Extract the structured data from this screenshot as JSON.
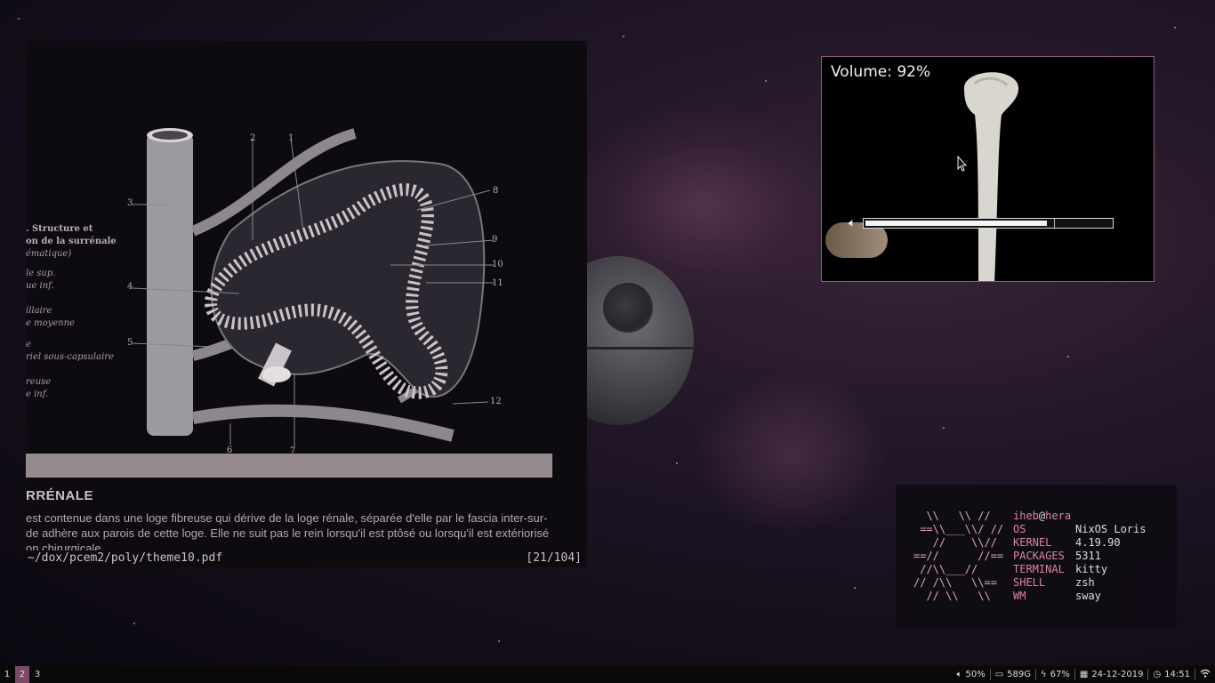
{
  "pdf_viewer": {
    "figure": {
      "side_caption": {
        "title_line1": ". Structure et",
        "title_line2": "on de la surrénale",
        "subtitle": "ématique)",
        "items": [
          "le sup.",
          "ue inf.",
          "illaire",
          "e moyenne",
          "e",
          "riel sous-capsulaire",
          "reuse",
          "e inf."
        ]
      },
      "numbers": [
        "1",
        "2",
        "3",
        "4",
        "5",
        "6",
        "7",
        "8",
        "9",
        "10",
        "11",
        "12"
      ]
    },
    "heading": "RRÉNALE",
    "paragraph_lines": [
      "est contenue dans une loge fibreuse qui dérive de la loge rénale, séparée d'elle par le fascia inter-sur-",
      "de adhère aux parois de cette loge. Elle ne suit pas le rein lorsqu'il est ptôsé ou lorsqu'il est extériorisé",
      "on chirurgicale."
    ],
    "file_path": "~/dox/pcem2/poly/theme10.pdf",
    "page_indicator": "[21/104]"
  },
  "video": {
    "volume_text": "Volume: 92%",
    "volume_level": 0.74
  },
  "fetch": {
    "ascii_art": "  \\\\   \\\\ //\n ==\\\\___\\\\/ //\n   //    \\\\//\n==//      //==\n //\\\\___//\n// /\\\\   \\\\==\n  // \\\\   \\\\",
    "user": "iheb",
    "at": "@",
    "host": "hera",
    "rows": [
      {
        "key": "OS",
        "value": "NixOS Loris"
      },
      {
        "key": "KERNEL",
        "value": "4.19.90"
      },
      {
        "key": "PACKAGES",
        "value": "5311"
      },
      {
        "key": "TERMINAL",
        "value": "kitty"
      },
      {
        "key": "SHELL",
        "value": "zsh"
      },
      {
        "key": "WM",
        "value": "sway"
      }
    ]
  },
  "taskbar": {
    "workspaces": [
      "1",
      "2",
      "3"
    ],
    "active_workspace": "2",
    "volume": "50%",
    "disk": "589G",
    "battery": "67%",
    "date": "24-12-2019",
    "time": "14:51",
    "accent_color": "#7a4a66"
  }
}
